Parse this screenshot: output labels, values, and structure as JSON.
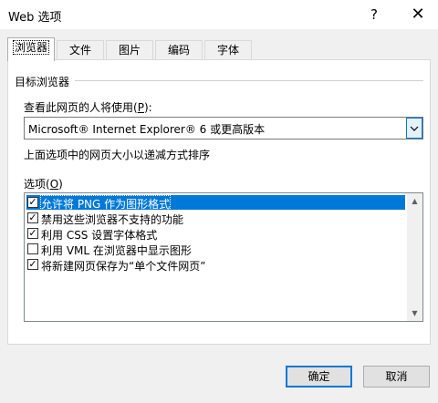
{
  "window": {
    "title": "Web 选项",
    "help_glyph": "?",
    "close_glyph": "✕"
  },
  "tabs": [
    {
      "label": "浏览器",
      "active": true
    },
    {
      "label": "文件"
    },
    {
      "label": "图片"
    },
    {
      "label": "编码"
    },
    {
      "label": "字体"
    }
  ],
  "section": {
    "title": "目标浏览器"
  },
  "viewer_prompt": {
    "text": "查看此网页的人将使用(",
    "accel": "P",
    "suffix": "):"
  },
  "browser_select": {
    "value": "Microsoft® Internet Explorer® 6 或更高版本"
  },
  "note": "上面选项中的网页大小以递减方式排序",
  "options_label": {
    "text": "选项(",
    "accel": "O",
    "suffix": ")"
  },
  "options": [
    {
      "label": "允许将 PNG 作为图形格式",
      "checked": true,
      "selected": true
    },
    {
      "label": "禁用这些浏览器不支持的功能",
      "checked": true
    },
    {
      "label": "利用 CSS 设置字体格式",
      "checked": true
    },
    {
      "label": "利用 VML 在浏览器中显示图形",
      "checked": false
    },
    {
      "label": "将新建网页保存为“单个文件网页”",
      "checked": true
    }
  ],
  "buttons": {
    "ok": "确定",
    "cancel": "取消"
  },
  "colors": {
    "accent": "#0078d7"
  }
}
